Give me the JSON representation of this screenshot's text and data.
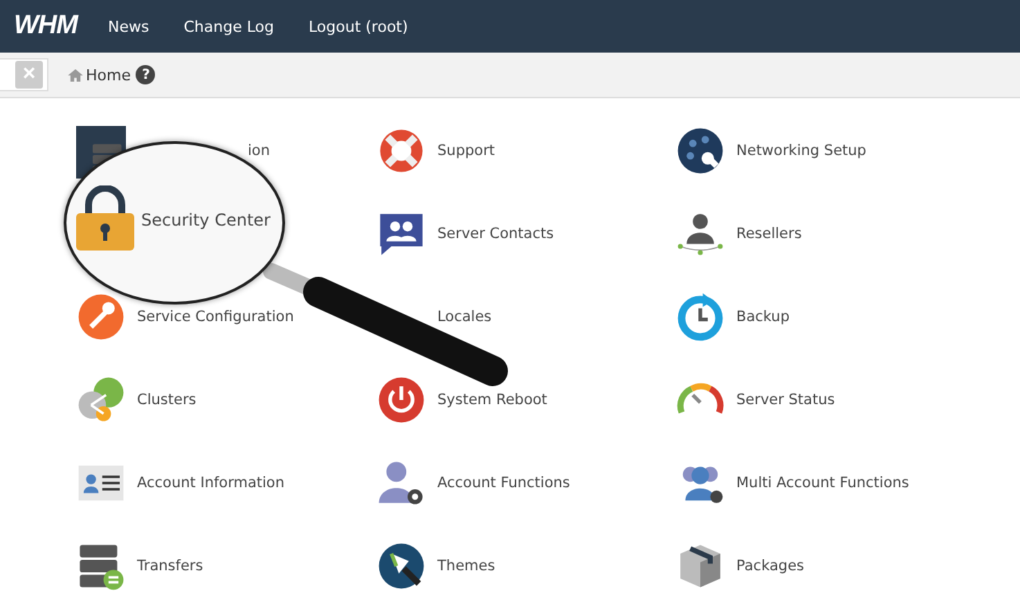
{
  "header": {
    "logo": "WHM",
    "nav": [
      "News",
      "Change Log",
      "Logout (root)"
    ]
  },
  "breadcrumb": {
    "clear_icon": "×",
    "label": "Home",
    "help": "?"
  },
  "tiles": [
    {
      "kind": "clipped",
      "label": "ion"
    },
    {
      "kind": "item",
      "label": "Support"
    },
    {
      "kind": "item",
      "label": "Networking Setup"
    },
    {
      "kind": "covered"
    },
    {
      "kind": "item",
      "label": "Server Contacts"
    },
    {
      "kind": "item",
      "label": "Resellers"
    },
    {
      "kind": "item",
      "label": "Service Configuration"
    },
    {
      "kind": "item",
      "label": "Locales"
    },
    {
      "kind": "item",
      "label": "Backup"
    },
    {
      "kind": "item",
      "label": "Clusters"
    },
    {
      "kind": "item",
      "label": "System Reboot"
    },
    {
      "kind": "item",
      "label": "Server Status"
    },
    {
      "kind": "item",
      "label": "Account Information"
    },
    {
      "kind": "item",
      "label": "Account Functions"
    },
    {
      "kind": "item",
      "label": "Multi Account Functions"
    },
    {
      "kind": "item",
      "label": "Transfers"
    },
    {
      "kind": "item",
      "label": "Themes"
    },
    {
      "kind": "item",
      "label": "Packages"
    }
  ],
  "magnifier": {
    "label": "Security Center"
  }
}
